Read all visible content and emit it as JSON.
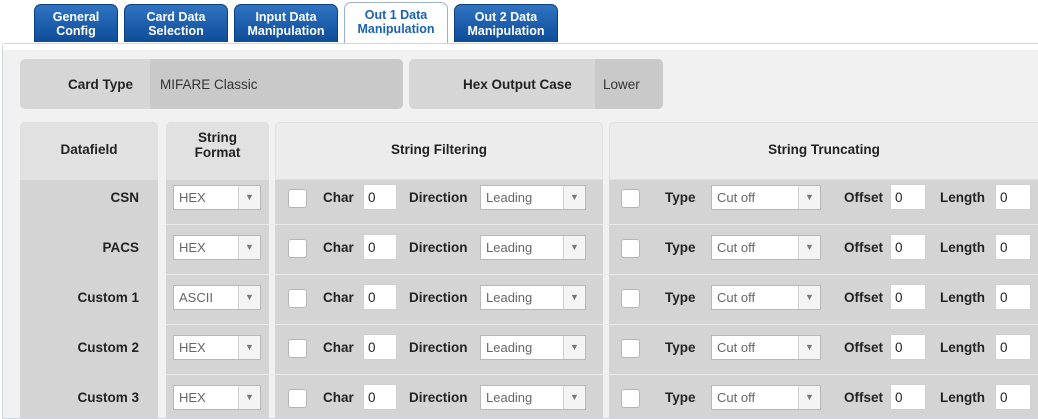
{
  "tabs": [
    {
      "line1": "General",
      "line2": "Config",
      "active": false
    },
    {
      "line1": "Card Data",
      "line2": "Selection",
      "active": false
    },
    {
      "line1": "Input Data",
      "line2": "Manipulation",
      "active": false
    },
    {
      "line1": "Out 1 Data",
      "line2": "Manipulation",
      "active": true
    },
    {
      "line1": "Out 2 Data",
      "line2": "Manipulation",
      "active": false
    }
  ],
  "card_type": {
    "label": "Card Type",
    "value": "MIFARE Classic"
  },
  "hex_output_case": {
    "label": "Hex Output Case",
    "value": "Lower"
  },
  "headers": {
    "datafield": "Datafield",
    "string_format_1": "String",
    "string_format_2": "Format",
    "string_filtering": "String Filtering",
    "string_truncating": "String Truncating"
  },
  "field_labels": {
    "char": "Char",
    "direction": "Direction",
    "type": "Type",
    "offset": "Offset",
    "length": "Length"
  },
  "rows": [
    {
      "name": "CSN",
      "format": "HEX",
      "char": "0",
      "direction": "Leading",
      "type": "Cut off",
      "offset": "0",
      "length": "0"
    },
    {
      "name": "PACS",
      "format": "HEX",
      "char": "0",
      "direction": "Leading",
      "type": "Cut off",
      "offset": "0",
      "length": "0"
    },
    {
      "name": "Custom 1",
      "format": "ASCII",
      "char": "0",
      "direction": "Leading",
      "type": "Cut off",
      "offset": "0",
      "length": "0"
    },
    {
      "name": "Custom 2",
      "format": "HEX",
      "char": "0",
      "direction": "Leading",
      "type": "Cut off",
      "offset": "0",
      "length": "0"
    },
    {
      "name": "Custom 3",
      "format": "HEX",
      "char": "0",
      "direction": "Leading",
      "type": "Cut off",
      "offset": "0",
      "length": "0"
    }
  ],
  "icons": {
    "dropdown": "chevron-down-icon"
  }
}
